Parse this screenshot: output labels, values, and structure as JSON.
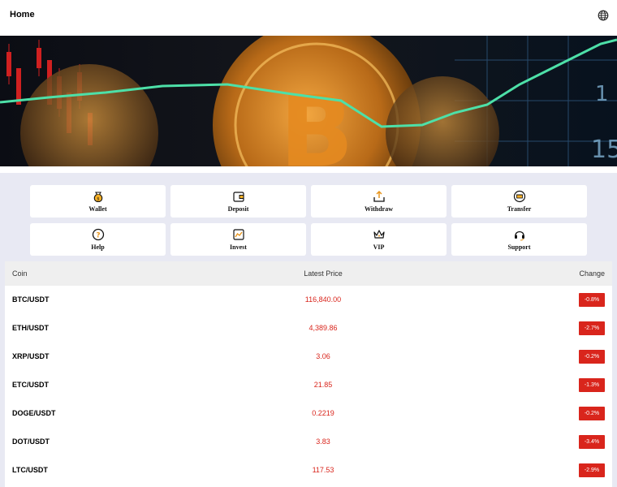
{
  "header": {
    "title": "Home",
    "icon": "globe-icon"
  },
  "banner": {
    "slides": 4,
    "active_slide": 2
  },
  "menu": [
    {
      "label": "Wallet",
      "icon": "wallet-icon"
    },
    {
      "label": "Deposit",
      "icon": "deposit-icon"
    },
    {
      "label": "Withdraw",
      "icon": "withdraw-icon"
    },
    {
      "label": "Transfer",
      "icon": "transfer-icon"
    },
    {
      "label": "Help",
      "icon": "help-icon"
    },
    {
      "label": "Invest",
      "icon": "invest-icon"
    },
    {
      "label": "VIP",
      "icon": "vip-crown-icon"
    },
    {
      "label": "Support",
      "icon": "headset-icon"
    }
  ],
  "table": {
    "headers": {
      "coin": "Coin",
      "price": "Latest Price",
      "change": "Change"
    },
    "rows": [
      {
        "coin": "BTC/USDT",
        "price": "116,840.00",
        "change": "-0.8%"
      },
      {
        "coin": "ETH/USDT",
        "price": "4,389.86",
        "change": "-2.7%"
      },
      {
        "coin": "XRP/USDT",
        "price": "3.06",
        "change": "-0.2%"
      },
      {
        "coin": "ETC/USDT",
        "price": "21.85",
        "change": "-1.3%"
      },
      {
        "coin": "DOGE/USDT",
        "price": "0.2219",
        "change": "-0.2%"
      },
      {
        "coin": "DOT/USDT",
        "price": "3.83",
        "change": "-3.4%"
      },
      {
        "coin": "LTC/USDT",
        "price": "117.53",
        "change": "-2.9%"
      }
    ]
  },
  "colors": {
    "accent_red": "#d9251c",
    "dot_active": "#2a7bd1",
    "page_bg": "#e8e9f3"
  }
}
